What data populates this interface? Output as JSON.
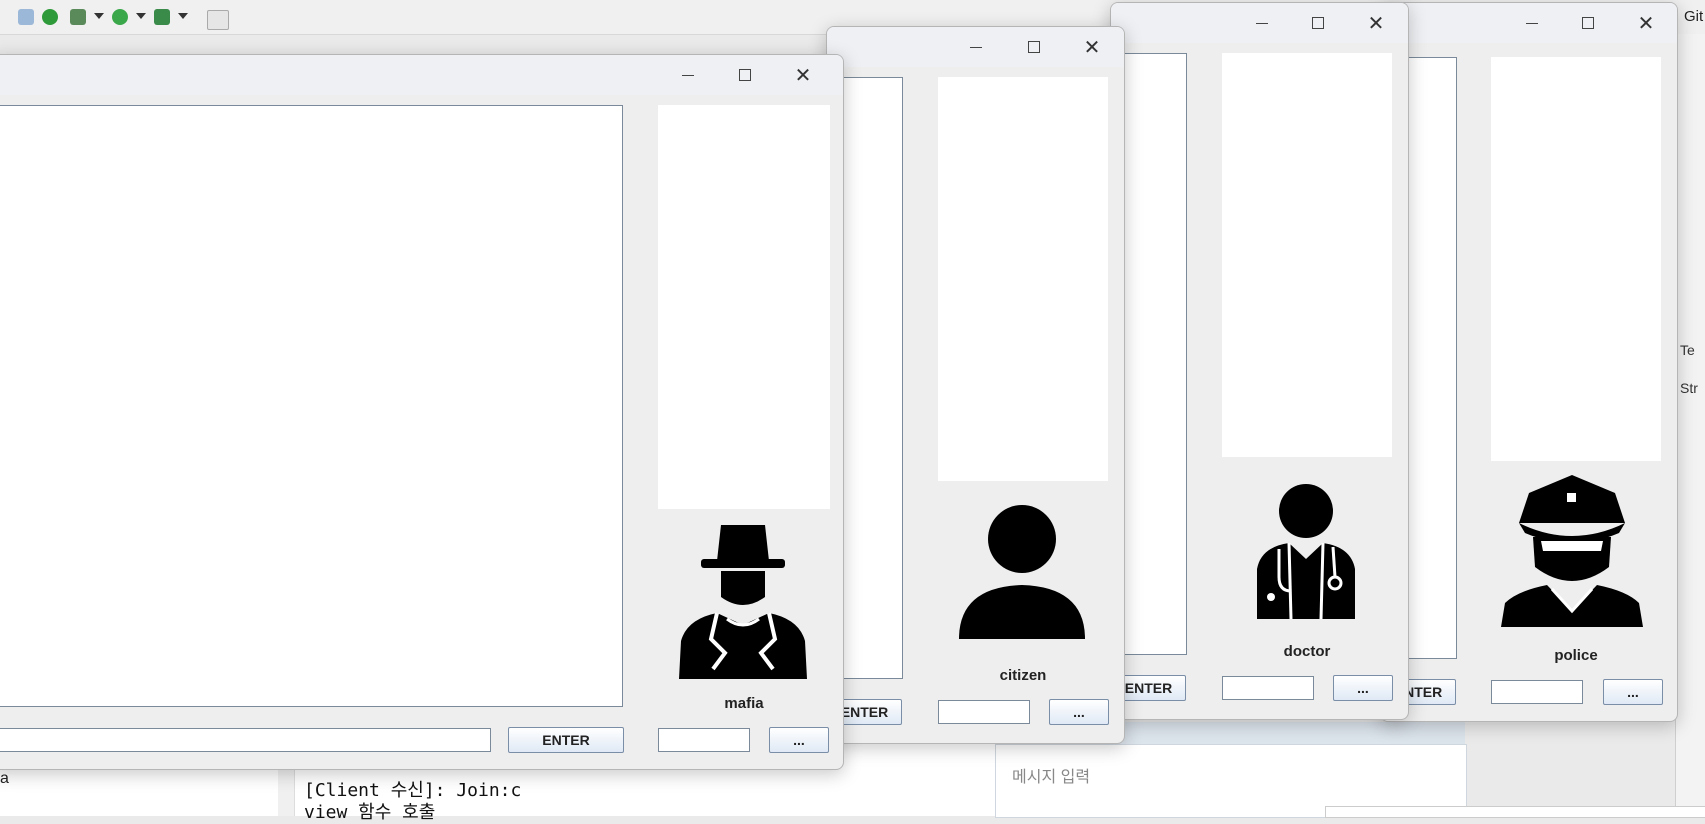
{
  "ide": {
    "git_label": "Git",
    "right_labels": [
      "Te",
      "Str"
    ],
    "console_lines": [
      "[Client 수신]: Join:c",
      "view 함수 호출"
    ],
    "left_text": "a",
    "message_placeholder": "메시지 입력"
  },
  "windows": [
    {
      "role": "mafia",
      "enter_label": "ENTER",
      "more_label": "...",
      "icon": "mafia-silhouette-icon"
    },
    {
      "role": "citizen",
      "enter_label": "ENTER",
      "more_label": "...",
      "icon": "citizen-silhouette-icon"
    },
    {
      "role": "doctor",
      "enter_label": "ENTER",
      "more_label": "...",
      "icon": "doctor-silhouette-icon"
    },
    {
      "role": "police",
      "enter_label": "ENTER",
      "more_label": "...",
      "icon": "police-silhouette-icon"
    }
  ],
  "window_controls": {
    "close_glyph": "✕"
  }
}
